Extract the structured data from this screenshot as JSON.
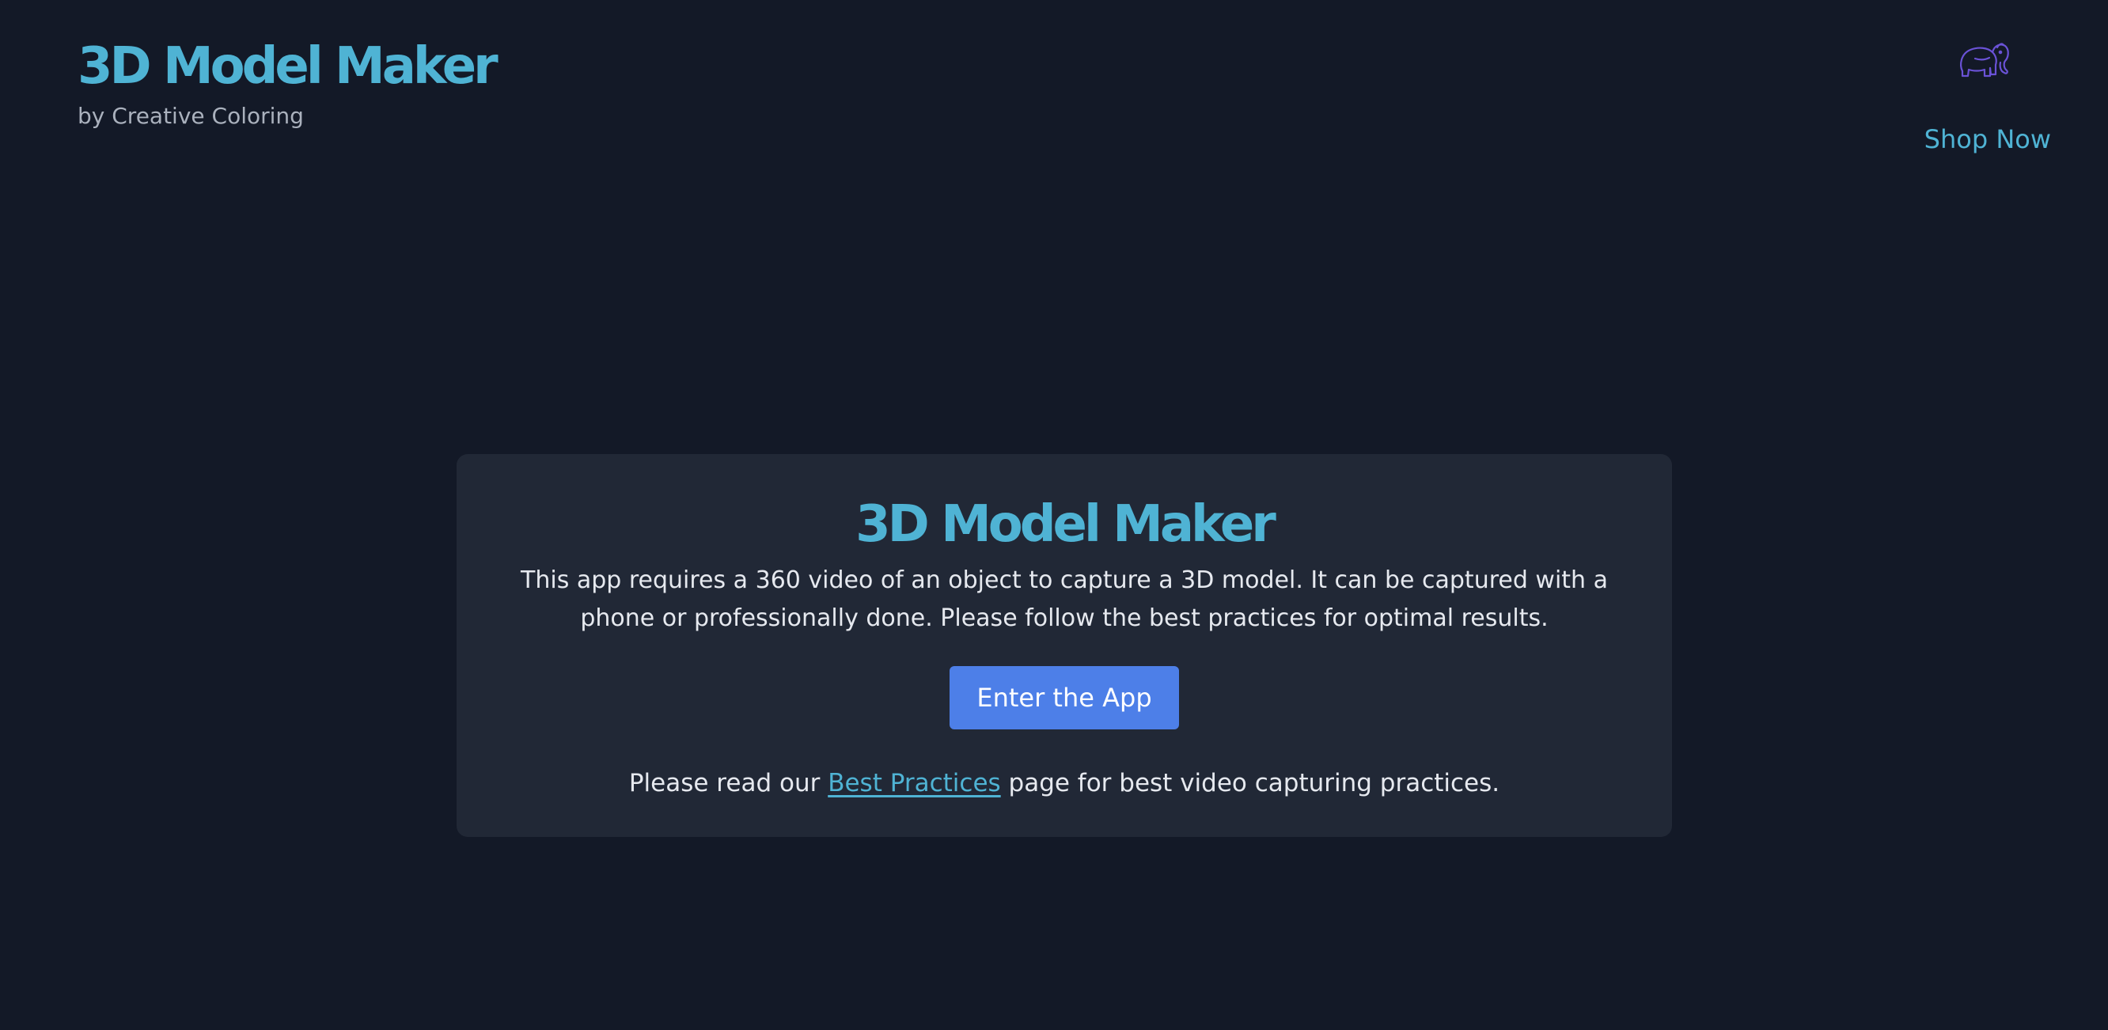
{
  "header": {
    "brand_title": "3D Model Maker",
    "brand_subtitle": "by Creative Coloring",
    "logo_icon": "elephant-icon",
    "shop_link": "Shop Now"
  },
  "card": {
    "title": "3D Model Maker",
    "description": "This app requires a 360 video of an object to capture a 3D model. It can be captured with a phone or professionally done. Please follow the best practices for optimal results.",
    "enter_button": "Enter the App",
    "footnote_prefix": "Please read our ",
    "footnote_link": "Best Practices",
    "footnote_suffix": " page for best video capturing practices."
  },
  "colors": {
    "background": "#131927",
    "card_background": "#212836",
    "accent": "#4fb3d4",
    "button": "#4d7fe8",
    "logo": "#6a52d6"
  }
}
